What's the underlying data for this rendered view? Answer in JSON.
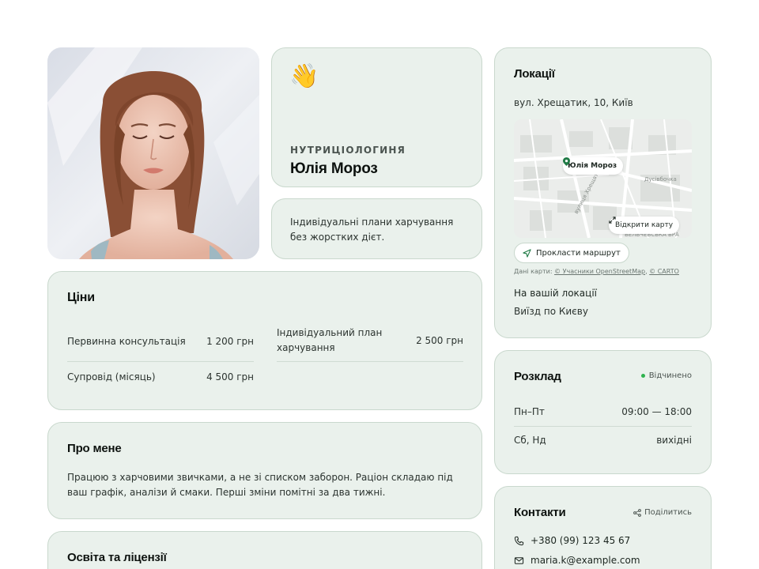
{
  "profile": {
    "role": "НУТРИЦІОЛОГИНЯ",
    "name": "Юлія Мороз",
    "tagline": "Індивідуальні плани харчування без жорстких дієт."
  },
  "prices": {
    "title": "Ціни",
    "items": [
      {
        "label": "Первинна консультація",
        "amount": "1 200 грн"
      },
      {
        "label": "Індивідуальний план харчування",
        "amount": "2 500 грн"
      },
      {
        "label": "Супровід (місяць)",
        "amount": "4 500 грн"
      }
    ]
  },
  "about": {
    "title": "Про мене",
    "text": "Працюю з харчовими звичками, а не зі списком заборон. Раціон складаю під ваш графік, аналізи й смаки. Перші зміни помітні за два тижні."
  },
  "education": {
    "title": "Освіта та ліцензії"
  },
  "locations": {
    "title": "Локації",
    "address": "вул. Хрещатик, 10, Київ",
    "map": {
      "pin_label": "Юлія Мороз",
      "open_map": "Відкрити карту",
      "street_labels": [
        "вулиця Хрещатик",
        "Дусівбочка",
        "БЕЛЬЧЕВСЬКА БРА"
      ]
    },
    "route_button": "Прокласти маршрут",
    "attribution": {
      "prefix": "Дані карти: ",
      "osm": "© Учасники OpenStreetMap",
      "sep": ", ",
      "carto": "© CARTO"
    },
    "onsite_title": "На вашій локації",
    "onsite_text": "Виїзд по Києву"
  },
  "schedule": {
    "title": "Розклад",
    "status": "Відчинено",
    "rows": [
      {
        "days": "Пн–Пт",
        "hours": "09:00 — 18:00"
      },
      {
        "days": "Сб, Нд",
        "hours": "вихідні"
      }
    ]
  },
  "contacts": {
    "title": "Контакти",
    "share": "Поділитись",
    "phone": "+380 (99) 123 45 67",
    "email": "maria.k@example.com"
  },
  "colors": {
    "card_bg": "#eaf1ec",
    "card_border": "#c9d8cd",
    "status_dot": "#2fb24e",
    "pin": "#1f7a45"
  },
  "icons": {
    "greeting": "waving-hand-icon",
    "pin": "map-pin-icon",
    "expand": "expand-icon",
    "route": "navigation-arrow-icon",
    "share": "share-icon",
    "phone": "phone-icon",
    "email": "mail-icon"
  }
}
